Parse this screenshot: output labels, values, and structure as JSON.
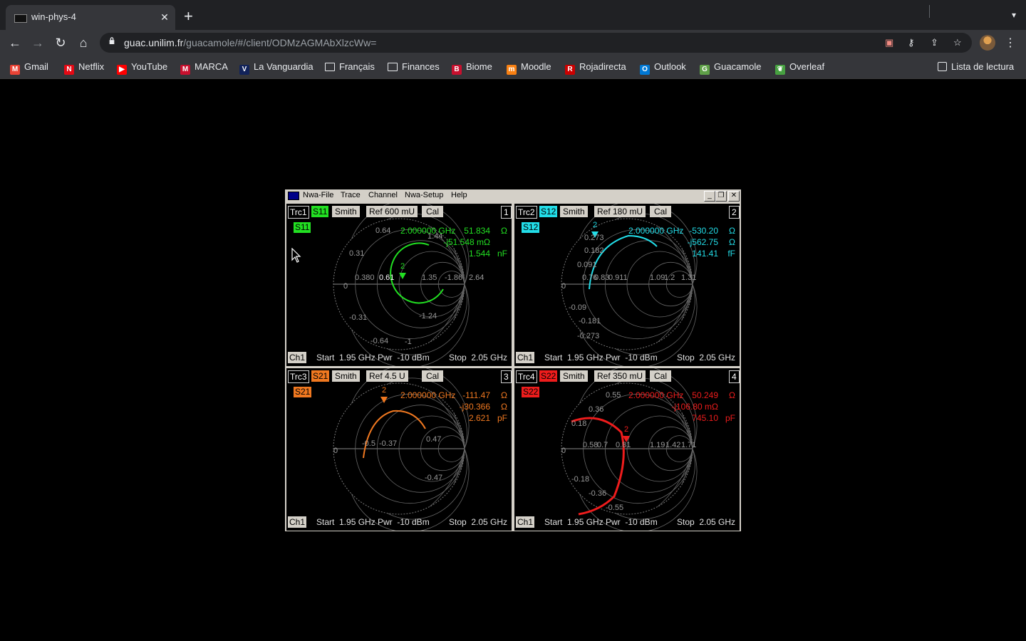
{
  "browser": {
    "tab_title": "win-phys-4",
    "url_host": "guac.unilim.fr",
    "url_path": "/guacamole/#/client/ODMzAGMAbXlzcWw=",
    "bookmarks": [
      {
        "label": "Gmail",
        "icon": "gmail-icon",
        "color": "#ea4335",
        "glyph": "M"
      },
      {
        "label": "Netflix",
        "icon": "netflix-icon",
        "color": "#e50914",
        "glyph": "N"
      },
      {
        "label": "YouTube",
        "icon": "youtube-icon",
        "color": "#ff0000",
        "glyph": "▶"
      },
      {
        "label": "MARCA",
        "icon": "marca-icon",
        "color": "#c8102e",
        "glyph": "M"
      },
      {
        "label": "La Vanguardia",
        "icon": "lavanguardia-icon",
        "color": "#12235a",
        "glyph": "V"
      },
      {
        "label": "Français",
        "icon": "folder-icon",
        "color": "",
        "glyph": ""
      },
      {
        "label": "Finances",
        "icon": "folder-icon",
        "color": "",
        "glyph": ""
      },
      {
        "label": "Biome",
        "icon": "biome-icon",
        "color": "#c8102e",
        "glyph": "B"
      },
      {
        "label": "Moodle",
        "icon": "moodle-icon",
        "color": "#f98012",
        "glyph": "m"
      },
      {
        "label": "Rojadirecta",
        "icon": "rojadirecta-icon",
        "color": "#cc0000",
        "glyph": "R"
      },
      {
        "label": "Outlook",
        "icon": "outlook-icon",
        "color": "#0078d4",
        "glyph": "O"
      },
      {
        "label": "Guacamole",
        "icon": "guacamole-icon",
        "color": "#5fa048",
        "glyph": "G"
      },
      {
        "label": "Overleaf",
        "icon": "overleaf-icon",
        "color": "#47a141",
        "glyph": "❦"
      }
    ],
    "reading_list": "Lista de lectura"
  },
  "nwa": {
    "menus": [
      "Nwa-File",
      "Trace",
      "Channel",
      "Nwa-Setup",
      "Help"
    ],
    "panes": [
      {
        "trc": "Trc1",
        "param": "S11",
        "format": "Smith",
        "ref": "Ref 600 mU",
        "cal": "Cal",
        "num": "1",
        "color": "#22e022",
        "chip_text": "#000",
        "freq": "2.000000 GHz",
        "val1": "51.834",
        "u1": "Ω",
        "val2": "-j51.548 mΩ",
        "val3": "1.544",
        "u3": "nF",
        "footer": {
          "ch": "Ch1",
          "start": "Start  1.95 GHz",
          "pwr": "Pwr  -10 dBm",
          "stop": "Stop  2.05 GHz"
        },
        "grid_labels": [
          "0.64",
          "0.31",
          "0",
          "-0.31",
          "-0.64",
          "-1",
          "-1.24",
          "1.44",
          "0.380",
          "0.61",
          "1.35",
          "-1.86",
          "2.64"
        ],
        "marker_label": "2"
      },
      {
        "trc": "Trc2",
        "param": "S12",
        "format": "Smith",
        "ref": "Ref 180 mU",
        "cal": "Cal",
        "num": "2",
        "color": "#22dde8",
        "chip_text": "#000",
        "freq": "2.000000 GHz",
        "val1": "-530.20",
        "u1": "Ω",
        "val2": "-j562.75",
        "u2": "Ω",
        "val3": "141.41",
        "u3": "fF",
        "footer": {
          "ch": "Ch1",
          "start": "Start  1.95 GHz",
          "pwr": "Pwr  -10 dBm",
          "stop": "Stop  2.05 GHz"
        },
        "grid_labels": [
          "0.273",
          "0.182",
          "0.091",
          "0",
          "-0.09",
          "-0.181",
          "-0.273",
          "0.76",
          "0.83",
          "0.911",
          "1.09",
          "1.2",
          "1.31"
        ],
        "marker_label": "2"
      },
      {
        "trc": "Trc3",
        "param": "S21",
        "format": "Smith",
        "ref": "Ref 4.5 U",
        "cal": "Cal",
        "num": "3",
        "color": "#f07820",
        "chip_text": "#000",
        "freq": "2.000000 GHz",
        "val1": "-111.47",
        "u1": "Ω",
        "val2": "-j30.366",
        "u2": "Ω",
        "val3": "2.621",
        "u3": "pF",
        "footer": {
          "ch": "Ch1",
          "start": "Start  1.95 GHz",
          "pwr": "Pwr  -10 dBm",
          "stop": "Stop  2.05 GHz"
        },
        "grid_labels": [
          "0.47",
          "0",
          "-0.47",
          "-0.5",
          "-0.37"
        ],
        "marker_label": "2"
      },
      {
        "trc": "Trc4",
        "param": "S22",
        "format": "Smith",
        "ref": "Ref 350 mU",
        "cal": "Cal",
        "num": "4",
        "color": "#ee1c1c",
        "chip_text": "#000",
        "freq": "2.000000 GHz",
        "val1": "50.249",
        "u1": "Ω",
        "val2": "-j106.80 mΩ",
        "val3": "745.10",
        "u3": "pF",
        "footer": {
          "ch": "Ch1",
          "start": "Start  1.95 GHz",
          "pwr": "Pwr  -10 dBm",
          "stop": "Stop  2.05 GHz"
        },
        "grid_labels": [
          "0.55",
          "0.36",
          "0.18",
          "0",
          "-0.18",
          "-0.36",
          "-0.55",
          "0.58",
          "0.7",
          "0.81",
          "1.19",
          "1.42",
          "1.71"
        ],
        "marker_label": "2"
      }
    ]
  }
}
